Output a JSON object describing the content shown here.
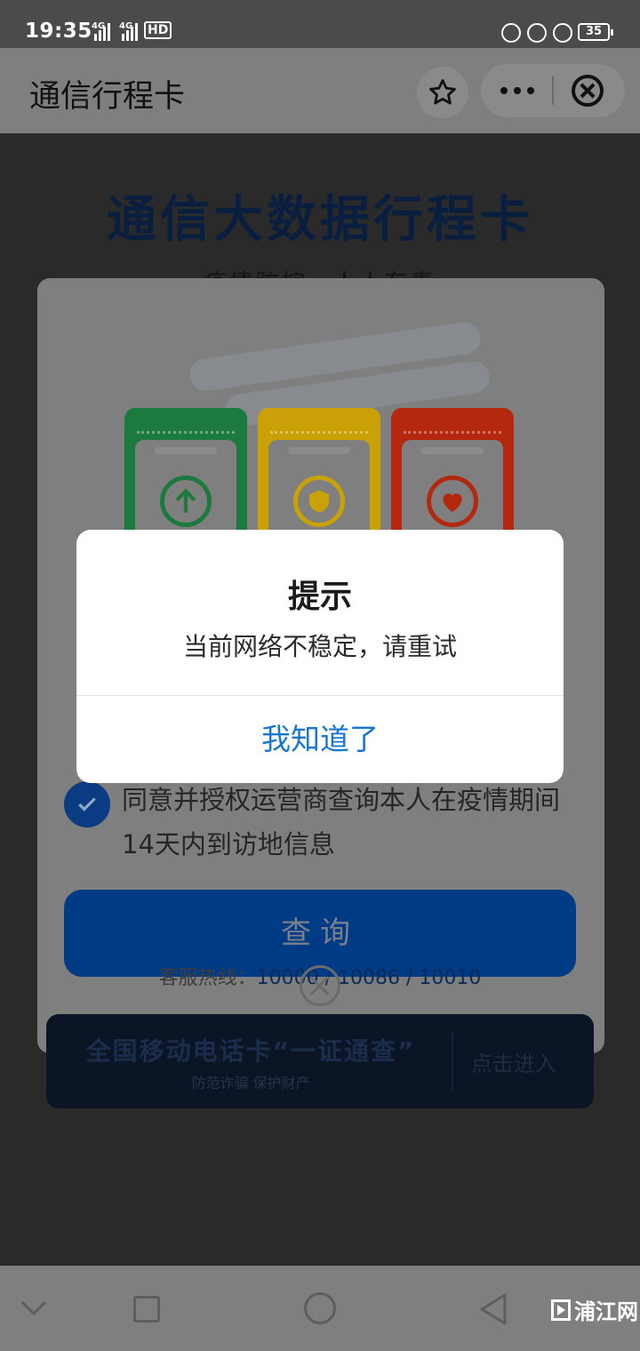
{
  "status_bar": {
    "time": "19:35",
    "network_1": "4G",
    "network_2": "4G",
    "hd": "HD",
    "battery": "35"
  },
  "header": {
    "title": "通信行程卡",
    "icons": [
      "star-icon",
      "more-icon",
      "close-icon"
    ]
  },
  "page": {
    "heading": "通信大数据行程卡",
    "subheading": "疫情防控，人人有责",
    "tickets": [
      {
        "color": "#1d7a3e",
        "icon": "arrow-up-icon"
      },
      {
        "color": "#c9a106",
        "icon": "shield-icon"
      },
      {
        "color": "#b3280e",
        "icon": "heart-icon"
      }
    ],
    "agree_text": "同意并授权运营商查询本人在疫情期间14天内到访地信息",
    "query_button": "查询",
    "hotline_label": "客服热线：",
    "hotline_numbers": "10000 / 10086 / 10010",
    "banner_title": "全国移动电话卡“一证通查”",
    "banner_sub": "防范诈骗 保护财产",
    "banner_cta": "点击进入"
  },
  "dialog": {
    "title": "提示",
    "message": "当前网络不稳定，请重试",
    "button": "我知道了"
  },
  "watermark": "浦江网"
}
